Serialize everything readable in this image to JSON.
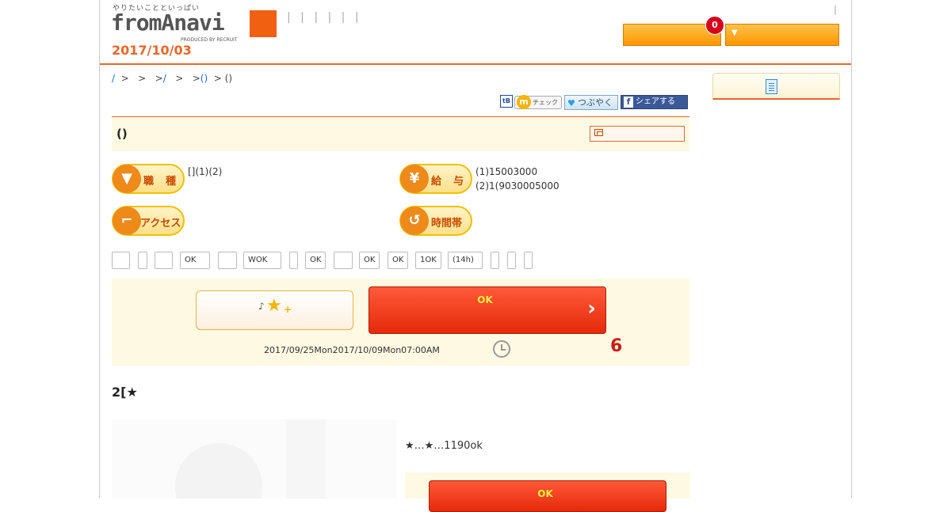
{
  "header": {
    "tagline": "やりたいことといっぱい",
    "logo_text": "fromAnavi",
    "logo_produced": "PRODUCED BY RECRUIT",
    "date": "2017/10/03",
    "dividers": "| | | | | |",
    "pipe": "|",
    "badge_count": "0",
    "dropdown_arrow": "▼"
  },
  "breadcrumb": {
    "part1": "/",
    "part2": "  >   >   >",
    "part3": "/",
    "part4": "   >   >",
    "part5": "()",
    "part6": "  > ()"
  },
  "social": {
    "tb": "tB",
    "check_m": "m",
    "check_label": "チェック",
    "tweet_label": "つぶやく",
    "share_label": "シェアする",
    "fb_letter": "f",
    "bird": "♥"
  },
  "job": {
    "title": "()",
    "category_label": "職　種",
    "category_value": "[](1)(2)",
    "salary_label": "給　与",
    "salary_line1": "(1)15003000",
    "salary_line2": "(2)1(9030005000",
    "access_label": "アクセス",
    "hours_label": "時間帯"
  },
  "tags": [
    "",
    "",
    "",
    "OK",
    "",
    "WOK",
    "",
    "OK",
    "",
    "OK",
    "OK",
    "1OK",
    "(14h)",
    "",
    "",
    ""
  ],
  "apply": {
    "keep_note": "♪",
    "star": "★",
    "plus": "+",
    "button_label": "OK",
    "chevron": "›",
    "period": "2017/09/25Mon2017/10/09Mon07:00AM",
    "days_left": "6"
  },
  "section": {
    "heading": "2[★",
    "catch_text": "★…★…1190ok",
    "button_label": "OK"
  }
}
